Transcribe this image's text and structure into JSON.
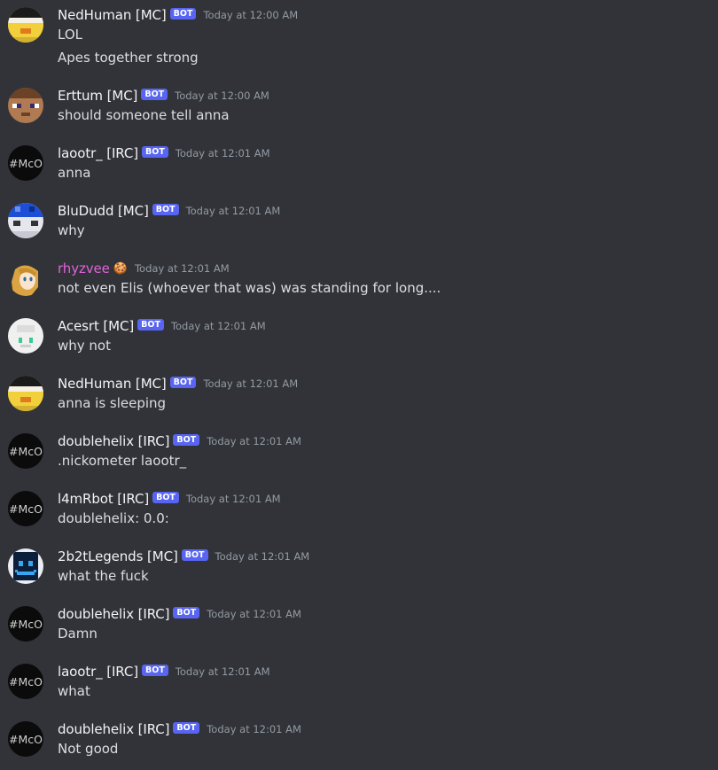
{
  "messages": [
    {
      "author": "NedHuman [MC]",
      "bot": true,
      "badge": "BOT",
      "timestamp": "Today at 12:00 AM",
      "lines": [
        "LOL",
        "Apes together strong"
      ],
      "avatar_icon": "pixel-duck-avatar"
    },
    {
      "author": "Erttum [MC]",
      "bot": true,
      "badge": "BOT",
      "timestamp": "Today at 12:00 AM",
      "lines": [
        "should someone tell anna"
      ],
      "avatar_icon": "pixel-steve-avatar"
    },
    {
      "author": "laootr_ [IRC]",
      "bot": true,
      "badge": "BOT",
      "timestamp": "Today at 12:01 AM",
      "lines": [
        "anna"
      ],
      "avatar_icon": "mco-avatar"
    },
    {
      "author": "BluDudd [MC]",
      "bot": true,
      "badge": "BOT",
      "timestamp": "Today at 12:01 AM",
      "lines": [
        "why"
      ],
      "avatar_icon": "pixel-blue-avatar"
    },
    {
      "author": "rhyzvee",
      "bot": false,
      "emoji": "🍪",
      "timestamp": "Today at 12:01 AM",
      "lines": [
        "not even Elis (whoever that was) was standing for long...."
      ],
      "avatar_icon": "anime-girl-avatar",
      "name_color": "#e063d9"
    },
    {
      "author": "Acesrt [MC]",
      "bot": true,
      "badge": "BOT",
      "timestamp": "Today at 12:01 AM",
      "lines": [
        "why not"
      ],
      "avatar_icon": "pixel-white-avatar"
    },
    {
      "author": "NedHuman [MC]",
      "bot": true,
      "badge": "BOT",
      "timestamp": "Today at 12:01 AM",
      "lines": [
        "anna is sleeping"
      ],
      "avatar_icon": "pixel-duck-avatar"
    },
    {
      "author": "doublehelix [IRC]",
      "bot": true,
      "badge": "BOT",
      "timestamp": "Today at 12:01 AM",
      "lines": [
        ".nickometer laootr_"
      ],
      "avatar_icon": "mco-avatar"
    },
    {
      "author": "l4mRbot [IRC]",
      "bot": true,
      "badge": "BOT",
      "timestamp": "Today at 12:01 AM",
      "lines": [
        "doublehelix: 0.0:"
      ],
      "avatar_icon": "mco-avatar"
    },
    {
      "author": "2b2tLegends [MC]",
      "bot": true,
      "badge": "BOT",
      "timestamp": "Today at 12:01 AM",
      "lines": [
        "what the fuck"
      ],
      "avatar_icon": "pixel-dark-avatar"
    },
    {
      "author": "doublehelix [IRC]",
      "bot": true,
      "badge": "BOT",
      "timestamp": "Today at 12:01 AM",
      "lines": [
        "Damn"
      ],
      "avatar_icon": "mco-avatar"
    },
    {
      "author": "laootr_ [IRC]",
      "bot": true,
      "badge": "BOT",
      "timestamp": "Today at 12:01 AM",
      "lines": [
        "what"
      ],
      "avatar_icon": "mco-avatar"
    },
    {
      "author": "doublehelix [IRC]",
      "bot": true,
      "badge": "BOT",
      "timestamp": "Today at 12:01 AM",
      "lines": [
        "Not good"
      ],
      "avatar_icon": "mco-avatar"
    }
  ],
  "mco_label": "#McO",
  "colors": {
    "background": "#313338",
    "bot_badge": "#5865f2",
    "timestamp": "#949ba4",
    "username": "#f2f3f5",
    "text": "#dbdee1"
  }
}
